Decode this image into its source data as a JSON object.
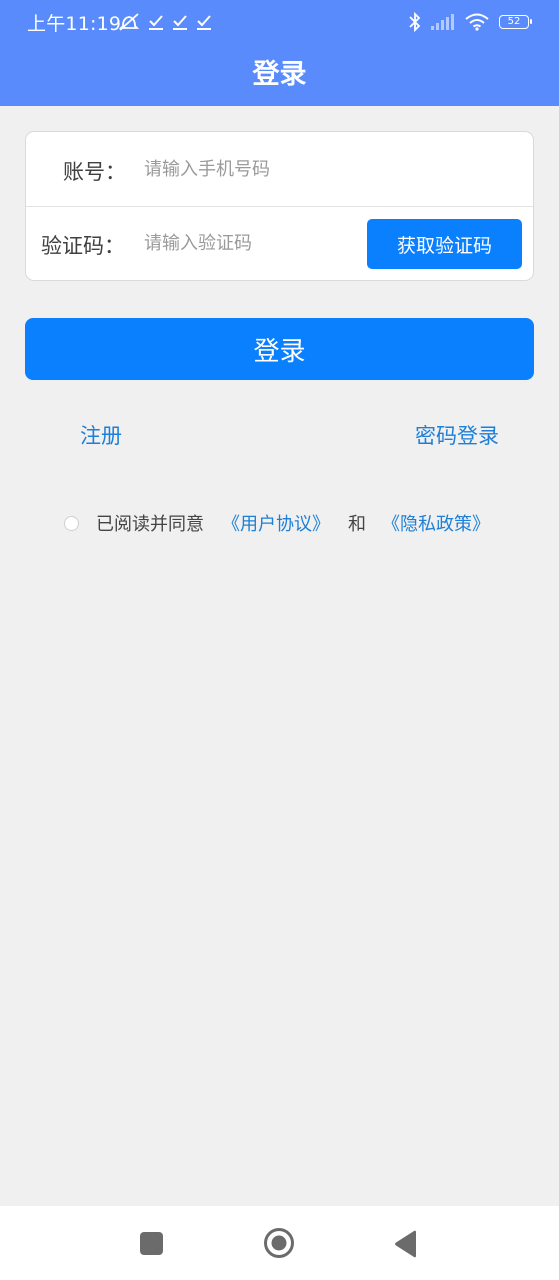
{
  "status_bar": {
    "time": "上午11:19",
    "battery": "52"
  },
  "header": {
    "title": "登录"
  },
  "form": {
    "account_label": "账号：",
    "account_placeholder": "请输入手机号码",
    "code_label": "验证码：",
    "code_placeholder": "请输入验证码",
    "get_code_button": "获取验证码"
  },
  "login_button": "登录",
  "links": {
    "register": "注册",
    "password_login": "密码登录"
  },
  "agreement": {
    "prefix": "已阅读并同意",
    "user_agreement": "《用户协议》",
    "and": "和",
    "privacy_policy": "《隐私政策》"
  },
  "colors": {
    "header_bg": "#5a8bfd",
    "primary": "#0a80ff",
    "link": "#1d7fd6",
    "page_bg": "#f0f0f0"
  }
}
